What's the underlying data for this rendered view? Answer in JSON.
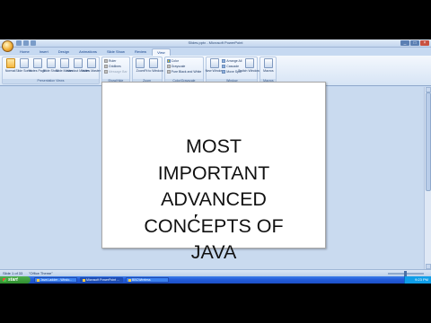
{
  "window": {
    "title": "Slides.pptx - Microsoft PowerPoint",
    "controls": {
      "minimize": "_",
      "maximize": "□",
      "close": "×"
    }
  },
  "tabs": [
    {
      "label": "Home"
    },
    {
      "label": "Insert"
    },
    {
      "label": "Design"
    },
    {
      "label": "Animations"
    },
    {
      "label": "Slide Show"
    },
    {
      "label": "Review"
    },
    {
      "label": "View",
      "active": true
    }
  ],
  "ribbon": {
    "presentation_views": {
      "label": "Presentation Views",
      "commands": [
        "Normal",
        "Slide Sorter",
        "Notes Page",
        "Slide Show",
        "Slide Master",
        "Handout Master",
        "Notes Master"
      ]
    },
    "show_hide": {
      "label": "Show/Hide",
      "items": [
        {
          "label": "Ruler"
        },
        {
          "label": "Gridlines"
        },
        {
          "label": "Message Bar",
          "disabled": true
        }
      ]
    },
    "zoom": {
      "label": "Zoom",
      "commands": [
        "Zoom",
        "Fit to Window"
      ]
    },
    "color": {
      "label": "Color/Grayscale",
      "items": [
        {
          "label": "Color"
        },
        {
          "label": "Grayscale"
        },
        {
          "label": "Pure Black and White"
        }
      ]
    },
    "window_group": {
      "label": "Window",
      "new_window": "New Window",
      "items": [
        {
          "label": "Arrange All"
        },
        {
          "label": "Cascade"
        },
        {
          "label": "Move Split"
        }
      ],
      "switch_windows": "Switch Windows"
    },
    "macros": {
      "label": "Macros",
      "command": "Macros"
    }
  },
  "slide": {
    "lines": [
      "MOST",
      "IMPORTANT",
      "ADVANCED",
      "CONCEPTS OF",
      "JAVA"
    ]
  },
  "statusbar": {
    "slide_info": "Slide 1 of 33",
    "theme": "\"Office Theme\""
  },
  "taskbar": {
    "start": "start",
    "tasks": [
      {
        "label": "Java Ladder - Windo..."
      },
      {
        "label": "Microsoft PowerPoint ..."
      },
      {
        "label": "BBCWireless"
      }
    ],
    "clock": "9:23 PM"
  }
}
